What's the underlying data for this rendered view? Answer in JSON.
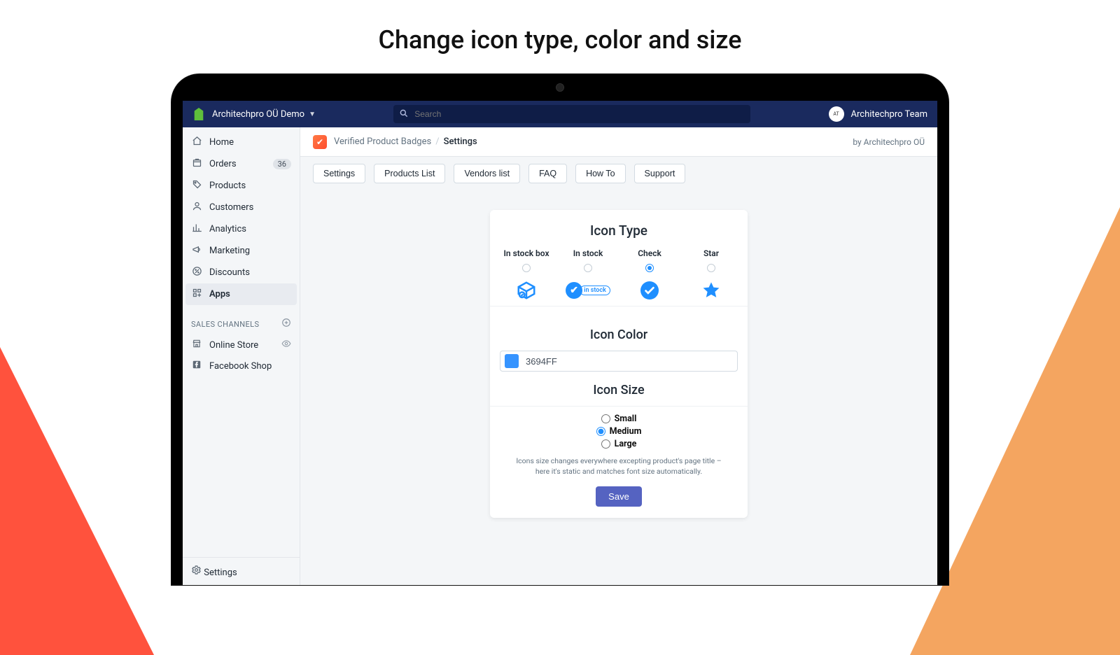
{
  "page_heading": "Change icon type, color and size",
  "topbar": {
    "store_name": "Architechpro OÜ Demo",
    "search_placeholder": "Search",
    "account_name": "Architechpro Team"
  },
  "sidebar": {
    "items": [
      {
        "icon": "home",
        "label": "Home"
      },
      {
        "icon": "orders",
        "label": "Orders",
        "badge": "36"
      },
      {
        "icon": "tag",
        "label": "Products"
      },
      {
        "icon": "person",
        "label": "Customers"
      },
      {
        "icon": "chart",
        "label": "Analytics"
      },
      {
        "icon": "mega",
        "label": "Marketing"
      },
      {
        "icon": "disc",
        "label": "Discounts"
      },
      {
        "icon": "apps",
        "label": "Apps",
        "active": true
      }
    ],
    "channels_header": "SALES CHANNELS",
    "channels": [
      {
        "icon": "store",
        "label": "Online Store",
        "trail": "eye"
      },
      {
        "icon": "fb",
        "label": "Facebook Shop"
      }
    ],
    "footer": {
      "icon": "gear",
      "label": "Settings"
    }
  },
  "breadcrumb": {
    "app_name": "Verified Product Badges",
    "page": "Settings",
    "byline": "by Architechpro OÜ"
  },
  "tabs": [
    "Settings",
    "Products List",
    "Vendors list",
    "FAQ",
    "How To",
    "Support"
  ],
  "card": {
    "icon_type_title": "Icon Type",
    "types": [
      {
        "key": "box",
        "label": "In stock box"
      },
      {
        "key": "stock",
        "label": "In stock",
        "pill_text": "in stock"
      },
      {
        "key": "check",
        "label": "Check",
        "selected": true
      },
      {
        "key": "star",
        "label": "Star"
      }
    ],
    "icon_color_title": "Icon Color",
    "icon_color_value": "3694FF",
    "icon_color_hex": "#3694FF",
    "icon_size_title": "Icon Size",
    "sizes": [
      {
        "label": "Small"
      },
      {
        "label": "Medium",
        "selected": true
      },
      {
        "label": "Large"
      }
    ],
    "size_note": "Icons size changes everywhere excepting product's page title – here it's static and matches font size automatically.",
    "save_label": "Save"
  }
}
